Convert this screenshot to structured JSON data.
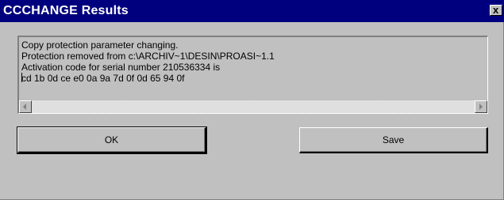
{
  "window": {
    "title": "CCCHANGE Results",
    "close_glyph": "x"
  },
  "results": {
    "line1": "Copy protection parameter changing.",
    "line2": "Protection removed from c:\\ARCHIV~1\\DESIN\\PROASI~1.1",
    "line3": "Activation code for serial number 210536334 is",
    "line4": "cd 1b 0d ce e0 0a 9a 7d 0f 0d 65 94 0f"
  },
  "buttons": {
    "ok_label": "OK",
    "save_label": "Save"
  },
  "icons": {
    "close": "close-icon",
    "scroll_left": "arrow-left-icon",
    "scroll_right": "arrow-right-icon"
  },
  "colors": {
    "titlebar": "#00007e",
    "face": "#c0c0c0"
  }
}
